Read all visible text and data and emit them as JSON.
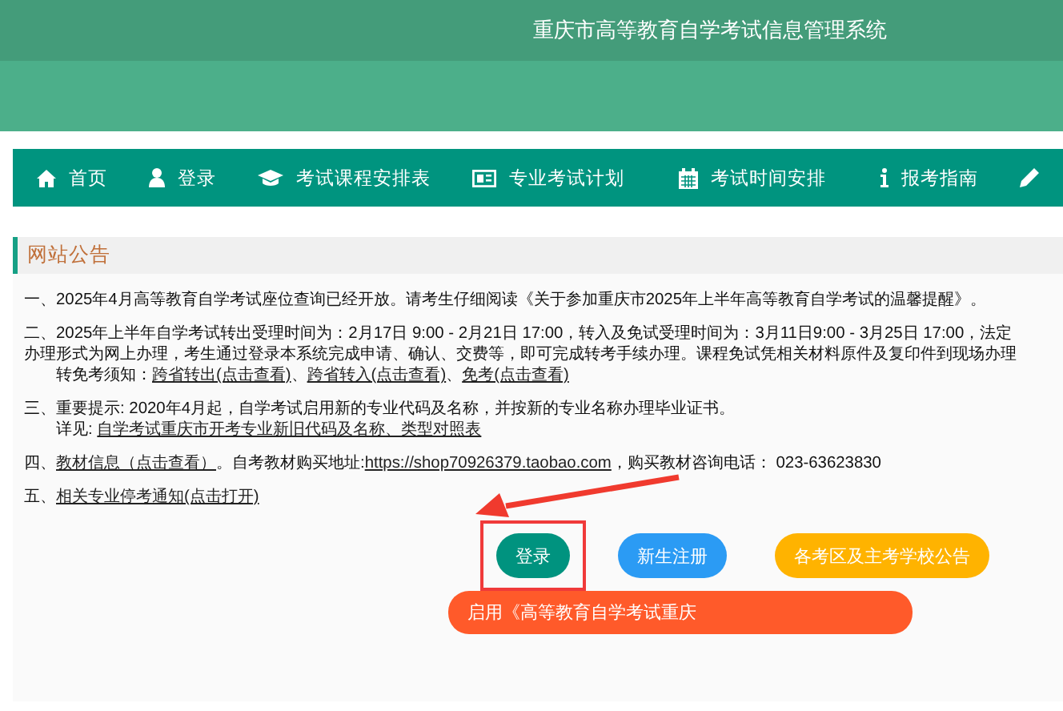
{
  "header": {
    "title": "重庆市高等教育自学考试信息管理系统"
  },
  "nav": [
    {
      "label": "首页",
      "kind": "home"
    },
    {
      "label": "登录",
      "kind": "user"
    },
    {
      "label": "考试课程安排表",
      "kind": "cap"
    },
    {
      "label": "专业考试计划",
      "kind": "card"
    },
    {
      "label": "考试时间安排",
      "kind": "calendar"
    },
    {
      "label": "报考指南",
      "kind": "info"
    },
    {
      "kind": "pencil"
    }
  ],
  "notice": {
    "title": "网站公告",
    "items": [
      {
        "parts": [
          {
            "kind": "text",
            "text": "一、2025年4月高等教育自学考试座位查询已经开放。请考生仔细阅读《关于参加重庆市2025年上半年高等教育自学考试的温馨提醒》。"
          }
        ]
      },
      {
        "parts": [
          {
            "kind": "text",
            "text": "二、2025年上半年自学考试转出受理时间为：2月17日 9:00 - 2月21日 17:00，转入及免试受理时间为：3月11日9:00 - 3月25日 17:00，法定"
          }
        ],
        "more": [
          {
            "parts": [
              {
                "kind": "text",
                "text": "办理形式为网上办理，考生通过登录本系统完成申请、确认、交费等，即可完成转考手续办理。课程免试凭相关材料原件及复印件到现场办理"
              }
            ]
          },
          {
            "indent": true,
            "parts": [
              {
                "kind": "text",
                "text": "转免考须知："
              },
              {
                "kind": "link",
                "text": "跨省转出(点击查看)"
              },
              {
                "kind": "text",
                "text": "、"
              },
              {
                "kind": "link",
                "text": "跨省转入(点击查看)"
              },
              {
                "kind": "text",
                "text": "、"
              },
              {
                "kind": "link",
                "text": "免考(点击查看)"
              }
            ]
          }
        ]
      },
      {
        "parts": [
          {
            "kind": "text",
            "text": "三、重要提示: 2020年4月起，自学考试启用新的专业代码及名称，并按新的专业名称办理毕业证书。"
          }
        ],
        "more": [
          {
            "indent": true,
            "parts": [
              {
                "kind": "text",
                "text": "详见: "
              },
              {
                "kind": "link",
                "text": "自学考试重庆市开考专业新旧代码及名称、类型对照表"
              }
            ]
          }
        ]
      },
      {
        "parts": [
          {
            "kind": "text",
            "text": "四、"
          },
          {
            "kind": "link",
            "text": "教材信息（点击查看）"
          },
          {
            "kind": "text",
            "text": "。自考教材购买地址:"
          },
          {
            "kind": "link",
            "text": "https://shop70926379.taobao.com"
          },
          {
            "kind": "text",
            "text": "，购买教材咨询电话： 023-63623830"
          }
        ]
      },
      {
        "parts": [
          {
            "kind": "text",
            "text": "五、"
          },
          {
            "kind": "link",
            "text": "相关专业停考通知(点击打开)"
          }
        ]
      }
    ]
  },
  "buttons": [
    {
      "label": "登录",
      "color": "#00937f",
      "highlighted": true
    },
    {
      "label": "新生注册",
      "color": "#2b9bf4",
      "highlighted": false
    },
    {
      "label": "各考区及主考学校公告",
      "color": "#ffb300",
      "highlighted": false
    }
  ],
  "banner": {
    "text": "启用《高等教育自学考试重庆"
  }
}
